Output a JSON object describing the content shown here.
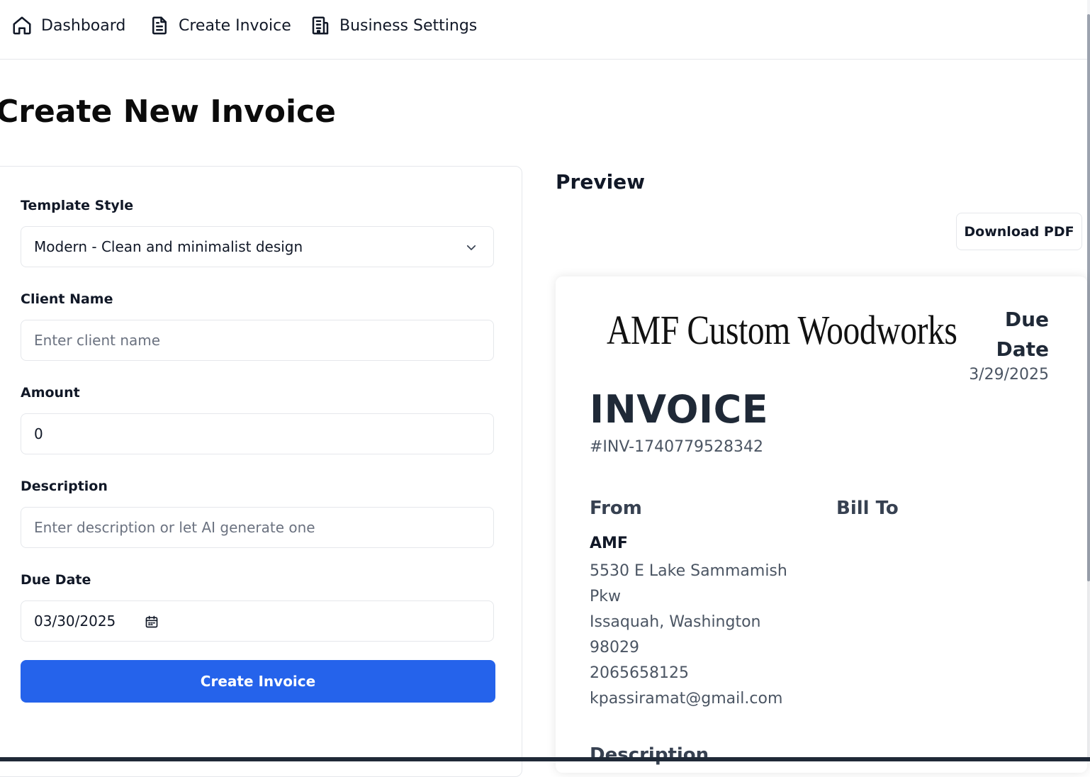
{
  "nav": {
    "items": [
      {
        "label": "Dashboard",
        "icon": "home-icon"
      },
      {
        "label": "Create Invoice",
        "icon": "document-icon"
      },
      {
        "label": "Business Settings",
        "icon": "building-icon"
      }
    ]
  },
  "page": {
    "title": "Create New Invoice"
  },
  "form": {
    "template_label": "Template Style",
    "template_value": "Modern - Clean and minimalist design",
    "client_label": "Client Name",
    "client_placeholder": "Enter client name",
    "amount_label": "Amount",
    "amount_value": "0",
    "description_label": "Description",
    "description_placeholder": "Enter description or let AI generate one",
    "due_label": "Due Date",
    "due_value": "03/30/2025",
    "submit_label": "Create Invoice"
  },
  "preview": {
    "heading": "Preview",
    "download_label": "Download PDF",
    "logo_text": "AMF Custom Woodworks",
    "due_label": "Due Date",
    "due_value": "3/29/2025",
    "title": "INVOICE",
    "number": "#INV-1740779528342",
    "from_heading": "From",
    "bill_to_heading": "Bill To",
    "from_name": "AMF",
    "from_lines": [
      "5530 E Lake Sammamish",
      "Pkw",
      "Issaquah, Washington",
      "98029",
      "2065658125",
      "kpassiramat@gmail.com"
    ],
    "description_heading": "Description"
  },
  "colors": {
    "accent": "#2563eb",
    "border": "#e5e7eb",
    "text": "#111827",
    "muted": "#4b5563"
  }
}
